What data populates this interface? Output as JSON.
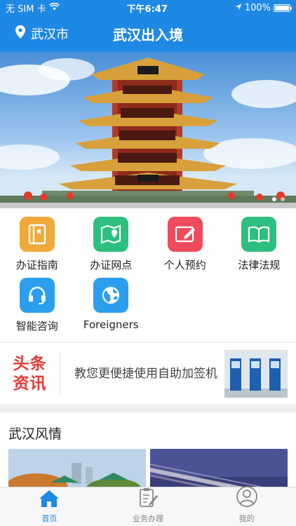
{
  "status_bar": {
    "carrier": "无 SIM 卡",
    "time": "下午6:47",
    "battery": "100%"
  },
  "header": {
    "location": "武汉市",
    "title": "武汉出入境",
    "pin_icon": "location-pin-icon"
  },
  "banner": {
    "slide_count": 2,
    "active_slide": 0
  },
  "services": [
    {
      "label": "办证指南",
      "icon": "guide-book-icon",
      "color": "#f1a93b"
    },
    {
      "label": "办证网点",
      "icon": "map-point-icon",
      "color": "#2cbf7e"
    },
    {
      "label": "个人预约",
      "icon": "appointment-edit-icon",
      "color": "#ef4b5c"
    },
    {
      "label": "法律法规",
      "icon": "law-book-icon",
      "color": "#2cbf7e"
    },
    {
      "label": "智能咨询",
      "icon": "headset-icon",
      "color": "#2b9fee"
    },
    {
      "label": "Foreigners",
      "icon": "globe-icon",
      "color": "#2b9fee"
    }
  ],
  "news": {
    "tag_line1": "头条",
    "tag_line2": "资讯",
    "headline": "教您更便捷使用自助加签机"
  },
  "section": {
    "title": "武汉风情"
  },
  "tabbar": [
    {
      "label": "首页",
      "icon": "home-icon",
      "active": true
    },
    {
      "label": "业务办理",
      "icon": "business-form-icon",
      "active": false
    },
    {
      "label": "我的",
      "icon": "user-profile-icon",
      "active": false
    }
  ],
  "colors": {
    "primary": "#1e88e5",
    "news_tag": "#e53935"
  }
}
